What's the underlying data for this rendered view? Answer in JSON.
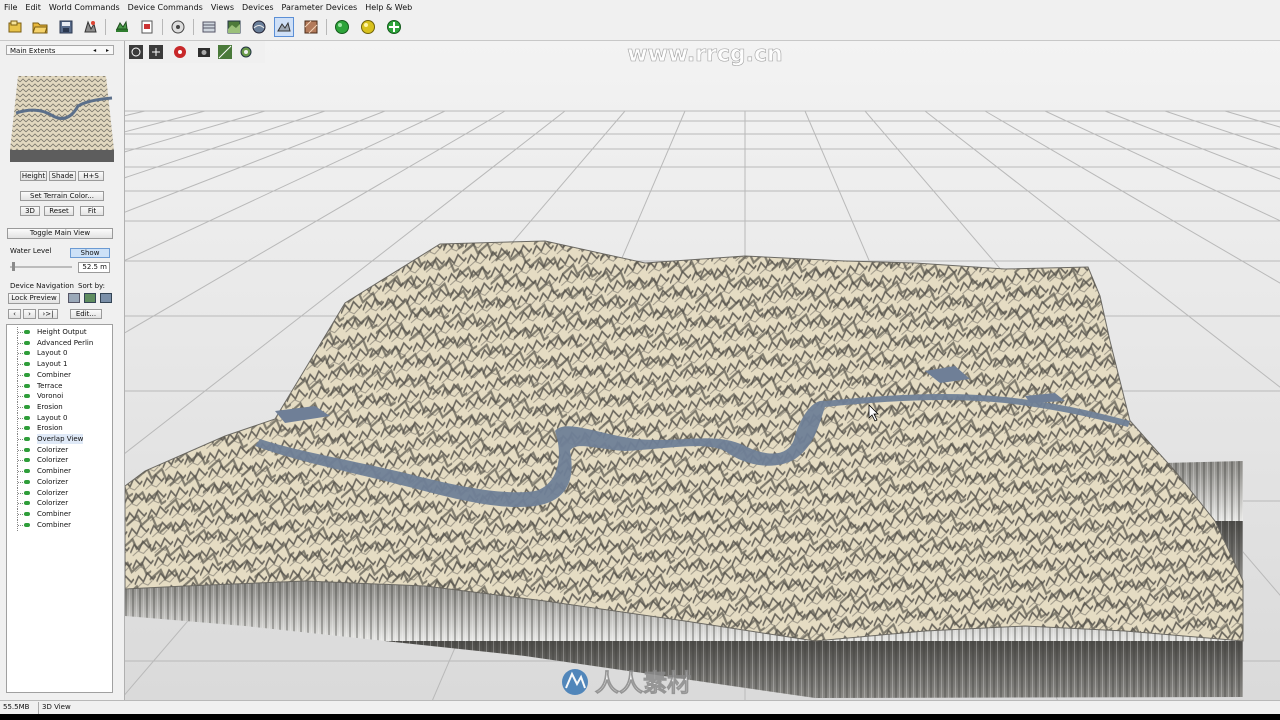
{
  "menu": [
    "File",
    "Edit",
    "World Commands",
    "Device Commands",
    "Views",
    "Devices",
    "Parameter Devices",
    "Help & Web"
  ],
  "toolbar": {
    "icons": [
      "new-file-icon",
      "open-folder-icon",
      "save-icon",
      "world-settings-icon",
      "build-icon",
      "export-icon",
      "render-tool-icon",
      "layers-icon",
      "view-icon",
      "terrain-view-icon",
      "texture-icon",
      "green-build-icon",
      "yellow-build-icon",
      "green-cross-icon"
    ]
  },
  "viewport_toolbar": {
    "icons": [
      "orbit-icon",
      "pan-icon",
      "render-red-icon",
      "camera-icon",
      "wireframe-icon",
      "settings-icon"
    ]
  },
  "watermark": "www.rrcg.cn",
  "watermark_bottom": "人人素材",
  "sidebar": {
    "panel_title": "Main Extents",
    "panel_arrows": "◂ ▸",
    "preview_buttons": [
      "Height",
      "Shade",
      "H+S"
    ],
    "set_terrain_color": "Set Terrain Color...",
    "view_buttons": [
      "3D",
      "Reset",
      "Fit"
    ],
    "toggle_main_view": "Toggle Main View",
    "water_level_label": "Water Level",
    "water_show": "Show",
    "water_value": "52.5 m",
    "device_navigation_label": "Device Navigation",
    "sort_by_label": "Sort by:",
    "lock_preview": "Lock Preview",
    "nav_buttons": [
      "‹",
      "›",
      "›>|"
    ],
    "edit_button": "Edit...",
    "devices": [
      {
        "label": "Height Output",
        "selected": false
      },
      {
        "label": "Advanced Perlin",
        "selected": false
      },
      {
        "label": "Layout 0",
        "selected": false
      },
      {
        "label": "Layout 1",
        "selected": false
      },
      {
        "label": "Combiner",
        "selected": false
      },
      {
        "label": "Terrace",
        "selected": false
      },
      {
        "label": "Voronoi",
        "selected": false
      },
      {
        "label": "Erosion",
        "selected": false
      },
      {
        "label": "Layout 0",
        "selected": false
      },
      {
        "label": "Erosion",
        "selected": false
      },
      {
        "label": "Overlap View",
        "selected": true
      },
      {
        "label": "Colorizer",
        "selected": false
      },
      {
        "label": "Colorizer",
        "selected": false
      },
      {
        "label": "Combiner",
        "selected": false
      },
      {
        "label": "Colorizer",
        "selected": false
      },
      {
        "label": "Colorizer",
        "selected": false
      },
      {
        "label": "Colorizer",
        "selected": false
      },
      {
        "label": "Combiner",
        "selected": false
      },
      {
        "label": "Combiner",
        "selected": false
      }
    ]
  },
  "status": {
    "memory": "55.5MB",
    "view_mode": "3D View"
  },
  "colors": {
    "terrain": "#e6ddc4",
    "terrain_shadow": "#5c5a55",
    "water": "#6f7f97",
    "grid_bg": "#e9e9e9",
    "device_dot": "#2f9e3a"
  }
}
